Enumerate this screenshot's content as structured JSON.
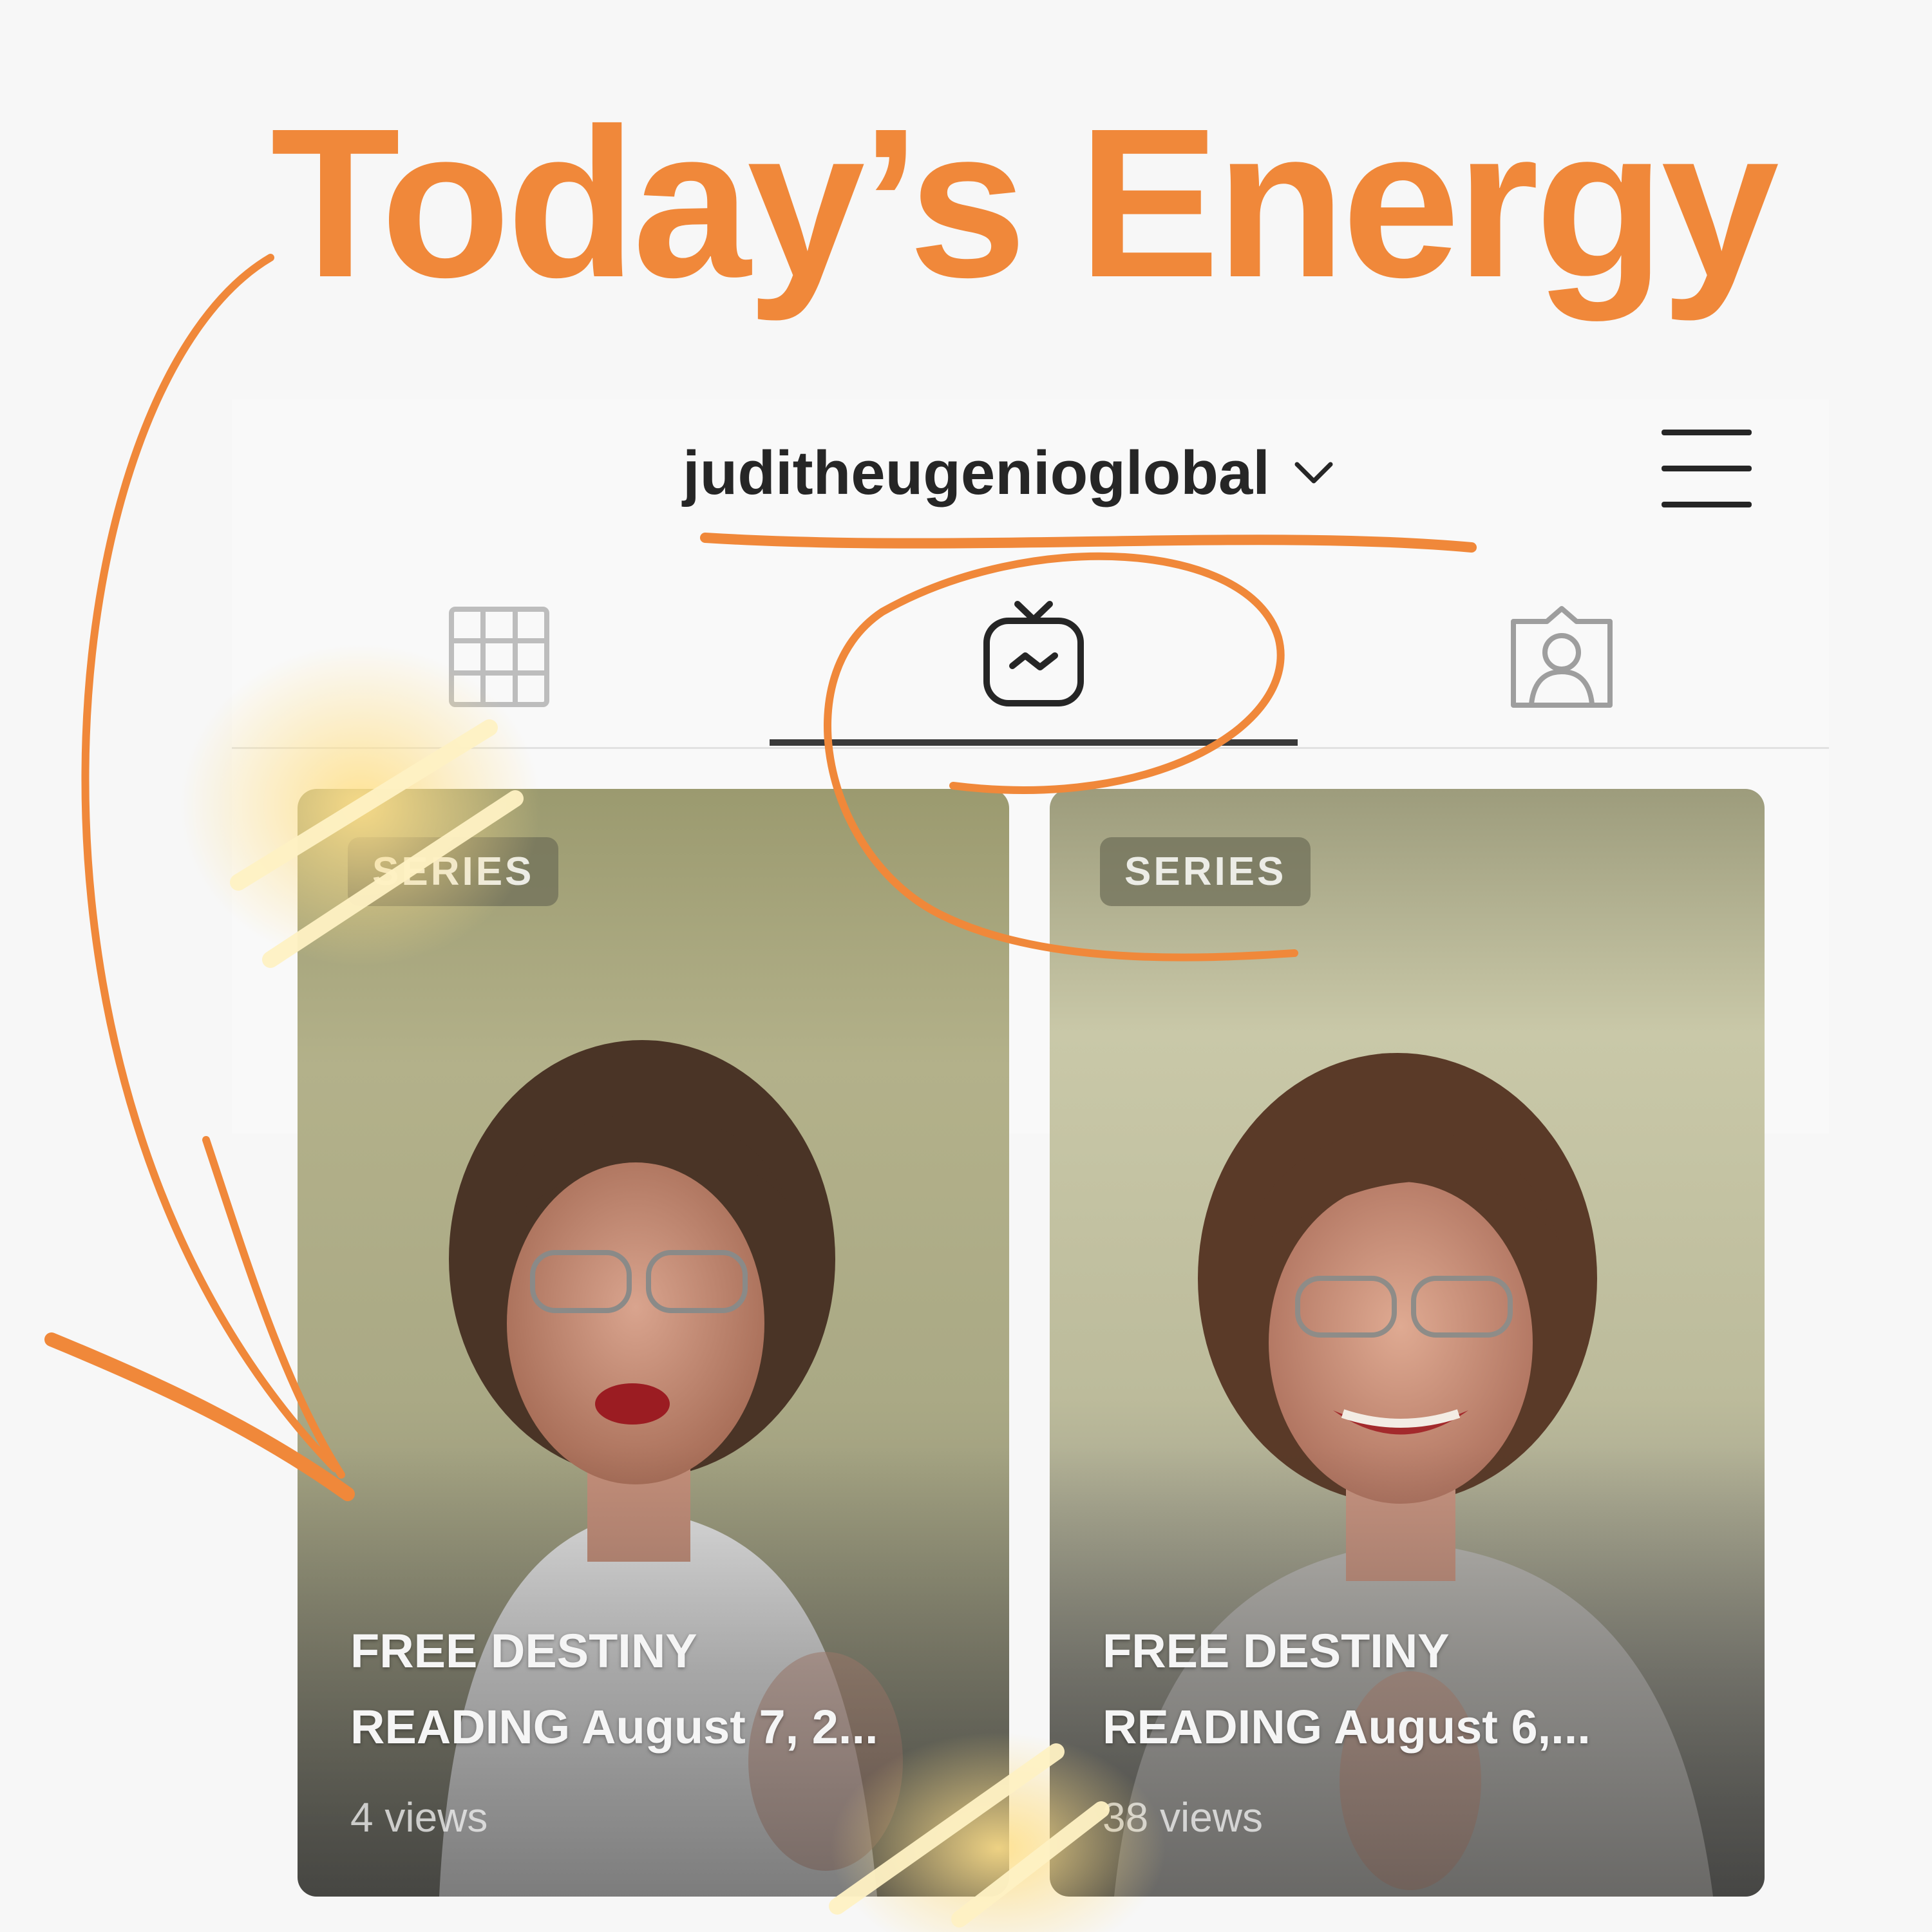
{
  "headline": "Today’s Energy",
  "header": {
    "username": "juditheugenioglobal"
  },
  "tabs": {
    "icons": [
      "grid-icon",
      "igtv-icon",
      "tagged-icon"
    ],
    "active": "igtv"
  },
  "videos": [
    {
      "badge": "SERIES",
      "title_line1": "FREE DESTINY",
      "title_line2": "READING August 7, 2...",
      "views": "4 views"
    },
    {
      "badge": "SERIES",
      "title_line1": "FREE DESTINY",
      "title_line2": "READING August 6,...",
      "views": "38 views"
    }
  ],
  "colors": {
    "accent": "#f0883a",
    "text": "#262626",
    "background": "#f7f7f7",
    "highlight": "#ffe08a"
  }
}
